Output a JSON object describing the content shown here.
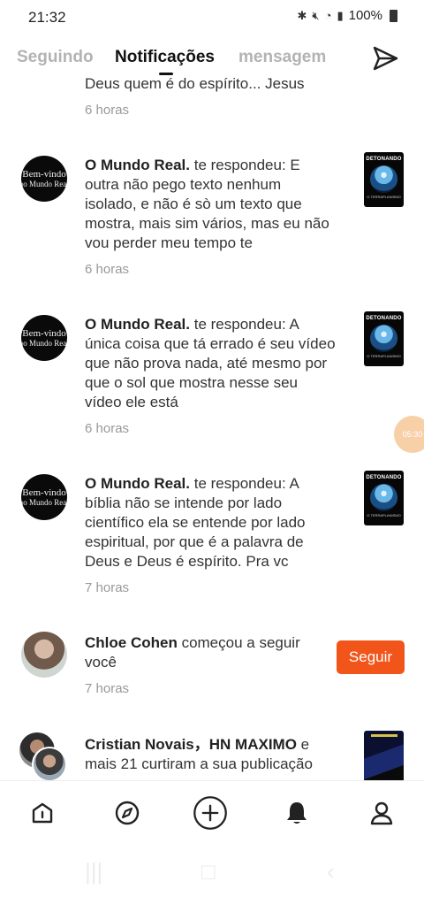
{
  "status_bar": {
    "time": "21:32",
    "battery": "100%"
  },
  "tabs": [
    {
      "label": "Seguindo"
    },
    {
      "label": "Notificações"
    },
    {
      "label": "mensagem"
    }
  ],
  "feed": {
    "fragment": {
      "text": "Deus quem é do espírito... Jesus",
      "time": "6 horas"
    },
    "items": [
      {
        "user": "O Mundo Real.",
        "action": " te respondeu: ",
        "text": "E outra não pego texto nenhum isolado, e não é sò um texto que mostra, mais sim vários, mas eu não vou perder meu tempo te",
        "time": "6 horas",
        "avatar": {
          "line1": "Bem-vindo",
          "line2": "ao Mundo Real"
        },
        "thumb": {
          "title": "DETONANDO",
          "sub": "O TERRAPLANISMO"
        }
      },
      {
        "user": "O Mundo Real.",
        "action": " te respondeu: ",
        "text": "A única coisa que tá errado é seu vídeo que não prova nada, até mesmo por que o sol que mostra nesse seu vídeo ele está",
        "time": "6 horas",
        "avatar": {
          "line1": "Bem-vindo",
          "line2": "ao Mundo Real"
        },
        "thumb": {
          "title": "DETONANDO",
          "sub": "O TERRAPLANISMO"
        }
      },
      {
        "user": "O Mundo Real.",
        "action": " te respondeu: ",
        "text": "A bíblia não se intende por lado científico ela se entende por lado espiritual, por que é a palavra de Deus e Deus é espírito. Pra vc",
        "time": "7 horas",
        "avatar": {
          "line1": "Bem-vindo",
          "line2": "ao Mundo Real"
        },
        "thumb": {
          "title": "DETONANDO",
          "sub": "O TERRAPLANISMO"
        }
      },
      {
        "user": "Chloe Cohen",
        "action": " começou a seguir você",
        "text": "",
        "time": "7 horas",
        "button": "Seguir"
      },
      {
        "user": "Cristian Novais，HN MAXIMO",
        "action": " e mais 21 curtiram a sua publicação",
        "text": ""
      }
    ]
  },
  "float_bubble": "05:30",
  "icons": {
    "send": "send-icon",
    "home": "home-icon",
    "discover": "compass-icon",
    "create": "plus-icon",
    "notifications": "bell-icon",
    "profile": "user-icon"
  },
  "colors": {
    "accent": "#f2551a",
    "active_tab": "#111111",
    "inactive_tab": "#b3b3b3"
  }
}
